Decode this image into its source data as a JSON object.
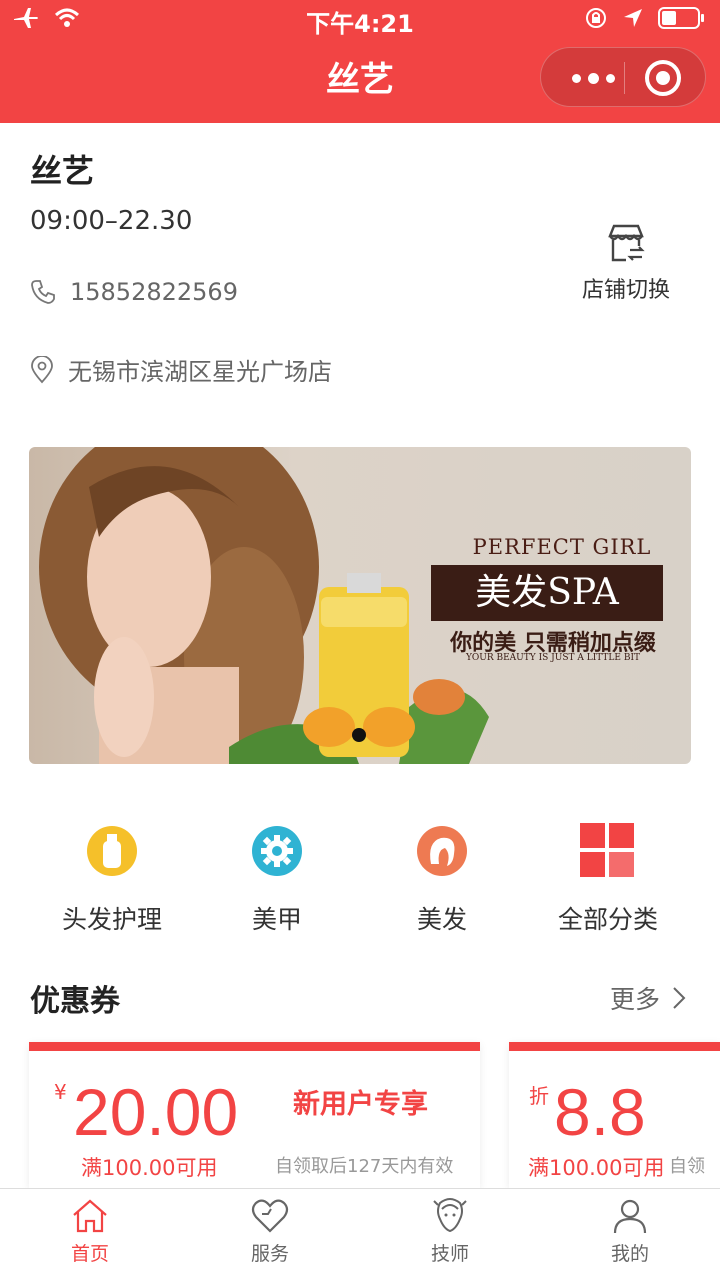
{
  "status_bar": {
    "time": "下午4:21"
  },
  "nav": {
    "title": "丝艺"
  },
  "store": {
    "name": "丝艺",
    "hours": "09:00–22.30",
    "phone": "15852822569",
    "address": "无锡市滨湖区星光广场店",
    "switch_label": "店铺切换"
  },
  "banner": {
    "line1": "PERFECT GIRL",
    "line2": "美发SPA",
    "line3": "你的美 只需稍加点缀",
    "line4": "YOUR BEAUTY IS JUST A LITTLE BIT"
  },
  "categories": [
    {
      "label": "头发护理",
      "icon": "bottle-icon",
      "color": "#f5c02a"
    },
    {
      "label": "美甲",
      "icon": "gear-icon",
      "color": "#2fb3d3"
    },
    {
      "label": "美发",
      "icon": "hair-icon",
      "color": "#ee7a52"
    },
    {
      "label": "全部分类",
      "icon": "grid-icon",
      "color": "#f24444"
    }
  ],
  "coupons_section": {
    "title": "优惠券",
    "more": "更多"
  },
  "coupons": [
    {
      "symbol": "¥",
      "amount": "20.00",
      "condition": "满100.00可用",
      "tag": "新用户专享",
      "validity": "自领取后127天内有效"
    },
    {
      "symbol": "折",
      "amount": "8.8",
      "condition": "满100.00可用",
      "validity": "自领"
    }
  ],
  "tabbar": [
    {
      "label": "首页",
      "icon": "home-icon",
      "active": true
    },
    {
      "label": "服务",
      "icon": "heart-icon",
      "active": false
    },
    {
      "label": "技师",
      "icon": "technician-icon",
      "active": false
    },
    {
      "label": "我的",
      "icon": "user-icon",
      "active": false
    }
  ],
  "colors": {
    "brand": "#f24444"
  }
}
